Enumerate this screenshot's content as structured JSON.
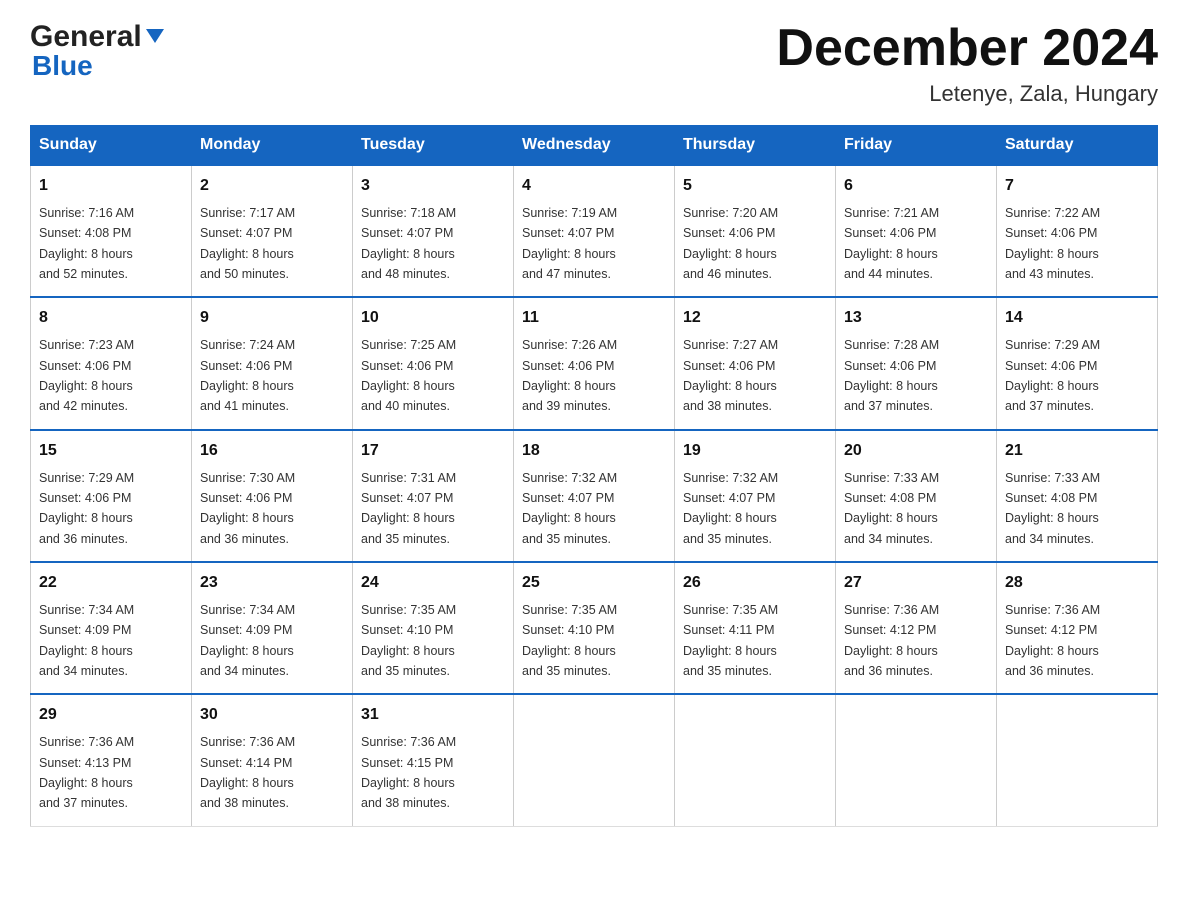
{
  "header": {
    "logo_general": "General",
    "logo_blue": "Blue",
    "month_title": "December 2024",
    "location": "Letenye, Zala, Hungary"
  },
  "days_of_week": [
    "Sunday",
    "Monday",
    "Tuesday",
    "Wednesday",
    "Thursday",
    "Friday",
    "Saturday"
  ],
  "weeks": [
    [
      {
        "day": "1",
        "sunrise": "7:16 AM",
        "sunset": "4:08 PM",
        "daylight": "8 hours and 52 minutes."
      },
      {
        "day": "2",
        "sunrise": "7:17 AM",
        "sunset": "4:07 PM",
        "daylight": "8 hours and 50 minutes."
      },
      {
        "day": "3",
        "sunrise": "7:18 AM",
        "sunset": "4:07 PM",
        "daylight": "8 hours and 48 minutes."
      },
      {
        "day": "4",
        "sunrise": "7:19 AM",
        "sunset": "4:07 PM",
        "daylight": "8 hours and 47 minutes."
      },
      {
        "day": "5",
        "sunrise": "7:20 AM",
        "sunset": "4:06 PM",
        "daylight": "8 hours and 46 minutes."
      },
      {
        "day": "6",
        "sunrise": "7:21 AM",
        "sunset": "4:06 PM",
        "daylight": "8 hours and 44 minutes."
      },
      {
        "day": "7",
        "sunrise": "7:22 AM",
        "sunset": "4:06 PM",
        "daylight": "8 hours and 43 minutes."
      }
    ],
    [
      {
        "day": "8",
        "sunrise": "7:23 AM",
        "sunset": "4:06 PM",
        "daylight": "8 hours and 42 minutes."
      },
      {
        "day": "9",
        "sunrise": "7:24 AM",
        "sunset": "4:06 PM",
        "daylight": "8 hours and 41 minutes."
      },
      {
        "day": "10",
        "sunrise": "7:25 AM",
        "sunset": "4:06 PM",
        "daylight": "8 hours and 40 minutes."
      },
      {
        "day": "11",
        "sunrise": "7:26 AM",
        "sunset": "4:06 PM",
        "daylight": "8 hours and 39 minutes."
      },
      {
        "day": "12",
        "sunrise": "7:27 AM",
        "sunset": "4:06 PM",
        "daylight": "8 hours and 38 minutes."
      },
      {
        "day": "13",
        "sunrise": "7:28 AM",
        "sunset": "4:06 PM",
        "daylight": "8 hours and 37 minutes."
      },
      {
        "day": "14",
        "sunrise": "7:29 AM",
        "sunset": "4:06 PM",
        "daylight": "8 hours and 37 minutes."
      }
    ],
    [
      {
        "day": "15",
        "sunrise": "7:29 AM",
        "sunset": "4:06 PM",
        "daylight": "8 hours and 36 minutes."
      },
      {
        "day": "16",
        "sunrise": "7:30 AM",
        "sunset": "4:06 PM",
        "daylight": "8 hours and 36 minutes."
      },
      {
        "day": "17",
        "sunrise": "7:31 AM",
        "sunset": "4:07 PM",
        "daylight": "8 hours and 35 minutes."
      },
      {
        "day": "18",
        "sunrise": "7:32 AM",
        "sunset": "4:07 PM",
        "daylight": "8 hours and 35 minutes."
      },
      {
        "day": "19",
        "sunrise": "7:32 AM",
        "sunset": "4:07 PM",
        "daylight": "8 hours and 35 minutes."
      },
      {
        "day": "20",
        "sunrise": "7:33 AM",
        "sunset": "4:08 PM",
        "daylight": "8 hours and 34 minutes."
      },
      {
        "day": "21",
        "sunrise": "7:33 AM",
        "sunset": "4:08 PM",
        "daylight": "8 hours and 34 minutes."
      }
    ],
    [
      {
        "day": "22",
        "sunrise": "7:34 AM",
        "sunset": "4:09 PM",
        "daylight": "8 hours and 34 minutes."
      },
      {
        "day": "23",
        "sunrise": "7:34 AM",
        "sunset": "4:09 PM",
        "daylight": "8 hours and 34 minutes."
      },
      {
        "day": "24",
        "sunrise": "7:35 AM",
        "sunset": "4:10 PM",
        "daylight": "8 hours and 35 minutes."
      },
      {
        "day": "25",
        "sunrise": "7:35 AM",
        "sunset": "4:10 PM",
        "daylight": "8 hours and 35 minutes."
      },
      {
        "day": "26",
        "sunrise": "7:35 AM",
        "sunset": "4:11 PM",
        "daylight": "8 hours and 35 minutes."
      },
      {
        "day": "27",
        "sunrise": "7:36 AM",
        "sunset": "4:12 PM",
        "daylight": "8 hours and 36 minutes."
      },
      {
        "day": "28",
        "sunrise": "7:36 AM",
        "sunset": "4:12 PM",
        "daylight": "8 hours and 36 minutes."
      }
    ],
    [
      {
        "day": "29",
        "sunrise": "7:36 AM",
        "sunset": "4:13 PM",
        "daylight": "8 hours and 37 minutes."
      },
      {
        "day": "30",
        "sunrise": "7:36 AM",
        "sunset": "4:14 PM",
        "daylight": "8 hours and 38 minutes."
      },
      {
        "day": "31",
        "sunrise": "7:36 AM",
        "sunset": "4:15 PM",
        "daylight": "8 hours and 38 minutes."
      },
      null,
      null,
      null,
      null
    ]
  ],
  "labels": {
    "sunrise": "Sunrise:",
    "sunset": "Sunset:",
    "daylight": "Daylight:"
  }
}
